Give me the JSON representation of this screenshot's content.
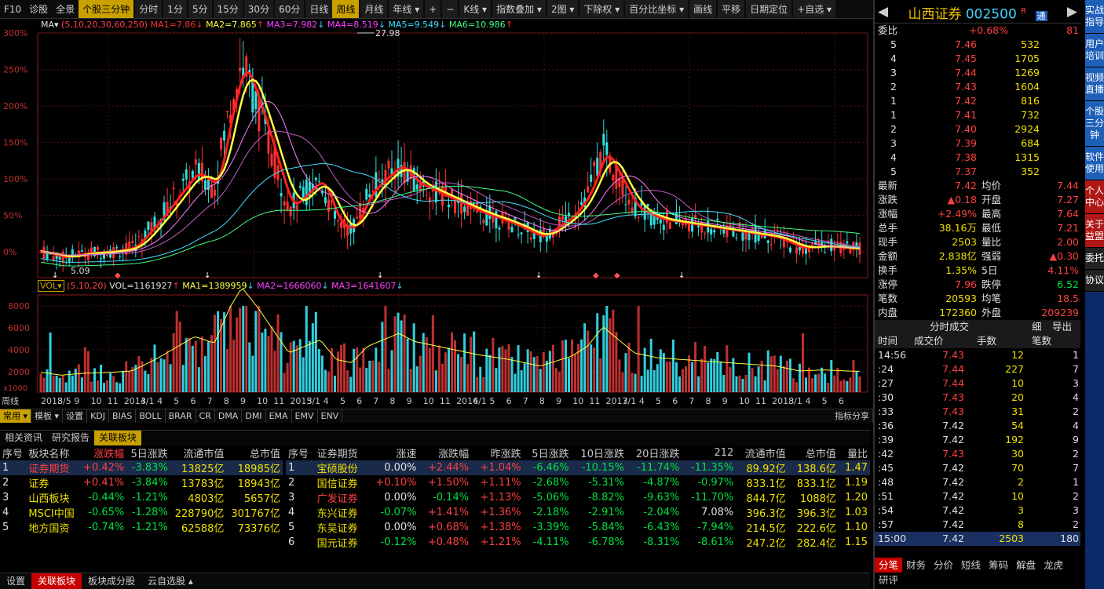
{
  "topbar": {
    "items": [
      "F10",
      "诊股",
      "全景",
      "个股三分钟",
      "分时",
      "1分",
      "5分",
      "15分",
      "30分",
      "60分",
      "日线",
      "周线",
      "月线",
      "年线 ▾",
      "+",
      "−",
      "K线 ▾",
      "指数叠加 ▾",
      "2图 ▾",
      "下除权 ▾",
      "百分比坐标 ▾",
      "画线",
      "平移",
      "日期定位",
      "+自选 ▾"
    ],
    "active": [
      "个股三分钟",
      "周线"
    ]
  },
  "ma": {
    "label": "MA▾",
    "params": "(5,10,20,30,60,250)",
    "ma1": "MA1=7.86",
    "ma2": "MA2=7.865",
    "ma3": "MA3=7.982",
    "ma4": "MA4=8.519",
    "ma5": "MA5=9.549",
    "ma6": "MA6=10.986"
  },
  "vol": {
    "label": "VOL▾",
    "params": "(5,10,20)",
    "vol": "VOL=1161927",
    "ma1": "MA1=1389959",
    "ma2": "MA2=1666060",
    "ma3": "MA3=1641607"
  },
  "annot": {
    "high": "27.98",
    "low": "5.09"
  },
  "chart_data": {
    "type": "candlestick",
    "title": "",
    "y_axis_labels": [
      "300%",
      "250%",
      "200%",
      "150%",
      "100%",
      "50%",
      "0%"
    ],
    "vol_axis_labels": [
      "8000",
      "6000",
      "4000",
      "2000"
    ],
    "vol_unit": "x1000",
    "x_labels": [
      "周线",
      "2013/5",
      "8",
      "9",
      "10",
      "11",
      "2014/1",
      "3",
      "4",
      "5",
      "6",
      "7",
      "8",
      "9",
      "10",
      "11",
      "2015/1",
      "3",
      "4",
      "5",
      "6",
      "7",
      "8",
      "9",
      "10",
      "11",
      "2016/1",
      "4",
      "5",
      "6",
      "7",
      "8",
      "9",
      "10",
      "11",
      "2017/1",
      "3",
      "4",
      "5",
      "6",
      "7",
      "8",
      "9",
      "10",
      "11",
      "2018/1",
      "3",
      "4",
      "5",
      "6"
    ]
  },
  "tooltabs": [
    "常用 ▾",
    "模板 ▾",
    "设置",
    "KDJ",
    "BIAS",
    "BOLL",
    "BRAR",
    "CR",
    "DMA",
    "DMI",
    "EMA",
    "EMV",
    "ENV",
    "指标分享"
  ],
  "midbar": [
    "相关资讯",
    "研究报告",
    "关联板块"
  ],
  "left": {
    "headers": [
      "序号",
      "板块名称",
      "涨跌幅",
      "5日涨跌",
      "流通市值",
      "总市值"
    ],
    "rows": [
      [
        "1",
        "证券期货",
        "+0.42%",
        "-3.83%",
        "13825亿",
        "18985亿"
      ],
      [
        "2",
        "证券",
        "+0.41%",
        "-3.84%",
        "13783亿",
        "18943亿"
      ],
      [
        "3",
        "山西板块",
        "-0.44%",
        "-1.21%",
        "4803亿",
        "5657亿"
      ],
      [
        "4",
        "MSCI中国",
        "-0.65%",
        "-1.28%",
        "228790亿",
        "301767亿"
      ],
      [
        "5",
        "地方国资",
        "-0.74%",
        "-1.21%",
        "62588亿",
        "73376亿"
      ]
    ]
  },
  "right": {
    "headers": [
      "序号",
      "证券期货",
      "涨速",
      "涨跌幅",
      "昨涨跌",
      "5日涨跌",
      "10日涨跌",
      "20日涨跌",
      "212",
      "流通市值",
      "总市值",
      "量比"
    ],
    "rows": [
      [
        "1",
        "宝硕股份",
        "0.00%",
        "+2.44%",
        "+1.04%",
        "-6.46%",
        "-10.15%",
        "-11.74%",
        "-11.35%",
        "89.92亿",
        "138.6亿",
        "1.47"
      ],
      [
        "2",
        "国信证券",
        "+0.10%",
        "+1.50%",
        "+1.11%",
        "-2.68%",
        "-5.31%",
        "-4.87%",
        "-0.97%",
        "833.1亿",
        "833.1亿",
        "1.19"
      ],
      [
        "3",
        "广发证券",
        "0.00%",
        "-0.14%",
        "+1.13%",
        "-5.06%",
        "-8.82%",
        "-9.63%",
        "-11.70%",
        "844.7亿",
        "1088亿",
        "1.20"
      ],
      [
        "4",
        "东兴证券",
        "-0.07%",
        "+1.41%",
        "+1.36%",
        "-2.18%",
        "-2.91%",
        "-2.04%",
        "7.08%",
        "396.3亿",
        "396.3亿",
        "1.03"
      ],
      [
        "5",
        "东吴证券",
        "0.00%",
        "+0.68%",
        "+1.38%",
        "-3.39%",
        "-5.84%",
        "-6.43%",
        "-7.94%",
        "214.5亿",
        "222.6亿",
        "1.10"
      ],
      [
        "6",
        "国元证券",
        "-0.12%",
        "+0.48%",
        "+1.21%",
        "-4.11%",
        "-6.78%",
        "-8.31%",
        "-8.61%",
        "247.2亿",
        "282.4亿",
        "1.15"
      ]
    ]
  },
  "bottom": [
    "设置",
    "关联板块",
    "板块成分股",
    "云自选股 ▴"
  ],
  "stock": {
    "name": "山西证券",
    "code": "002500",
    "flag": "R",
    "tag": "通"
  },
  "weibi": {
    "label": "委比",
    "val": "+0.68%",
    "num": "81"
  },
  "sell": [
    [
      "5",
      "7.46",
      "532"
    ],
    [
      "4",
      "7.45",
      "1705"
    ],
    [
      "3",
      "7.44",
      "1269"
    ],
    [
      "2",
      "7.43",
      "1604"
    ],
    [
      "1",
      "7.42",
      "816"
    ]
  ],
  "buy": [
    [
      "1",
      "7.41",
      "732"
    ],
    [
      "2",
      "7.40",
      "2924"
    ],
    [
      "3",
      "7.39",
      "684"
    ],
    [
      "4",
      "7.38",
      "1315"
    ],
    [
      "5",
      "7.37",
      "352"
    ]
  ],
  "quote": [
    [
      "最新",
      "7.42",
      "均价",
      "7.44"
    ],
    [
      "涨跌",
      "▲0.18",
      "开盘",
      "7.27"
    ],
    [
      "涨幅",
      "+2.49%",
      "最高",
      "7.64"
    ],
    [
      "总手",
      "38.16万",
      "最低",
      "7.21"
    ],
    [
      "现手",
      "2503",
      "量比",
      "2.00"
    ],
    [
      "金额",
      "2.838亿",
      "强弱",
      "▲0.30"
    ],
    [
      "换手",
      "1.35%",
      "5日",
      "4.11%"
    ],
    [
      "涨停",
      "7.96",
      "跌停",
      "6.52"
    ],
    [
      "笔数",
      "20593",
      "均笔",
      "18.5"
    ],
    [
      "内盘",
      "172360",
      "外盘",
      "209239"
    ]
  ],
  "ticks": {
    "title": "分时成交",
    "btn1": "细",
    "btn2": "导出",
    "headers": [
      "时间",
      "成交价",
      "手数",
      "笔数"
    ],
    "rows": [
      [
        "14:56",
        "7.43",
        "12",
        "1"
      ],
      [
        ":24",
        "7.44",
        "227",
        "7"
      ],
      [
        ":27",
        "7.44",
        "10",
        "3"
      ],
      [
        ":30",
        "7.43",
        "20",
        "4"
      ],
      [
        ":33",
        "7.43",
        "31",
        "2"
      ],
      [
        ":36",
        "7.42",
        "54",
        "4"
      ],
      [
        ":39",
        "7.42",
        "192",
        "9"
      ],
      [
        ":42",
        "7.43",
        "30",
        "2"
      ],
      [
        ":45",
        "7.42",
        "70",
        "7"
      ],
      [
        ":48",
        "7.42",
        "2",
        "1"
      ],
      [
        ":51",
        "7.42",
        "10",
        "2"
      ],
      [
        ":54",
        "7.42",
        "3",
        "3"
      ],
      [
        ":57",
        "7.42",
        "8",
        "2"
      ],
      [
        "15:00",
        "7.42",
        "2503",
        "180"
      ]
    ]
  },
  "rtabs": [
    "分笔",
    "财务",
    "分价",
    "短线",
    "筹码",
    "解盘",
    "龙虎",
    "研评"
  ],
  "sidebar": [
    "实战指导",
    "用户培训",
    "视频直播",
    "个股三分钟",
    "软件使用",
    "个人中心",
    "关于益盟",
    "委托",
    "协议"
  ]
}
